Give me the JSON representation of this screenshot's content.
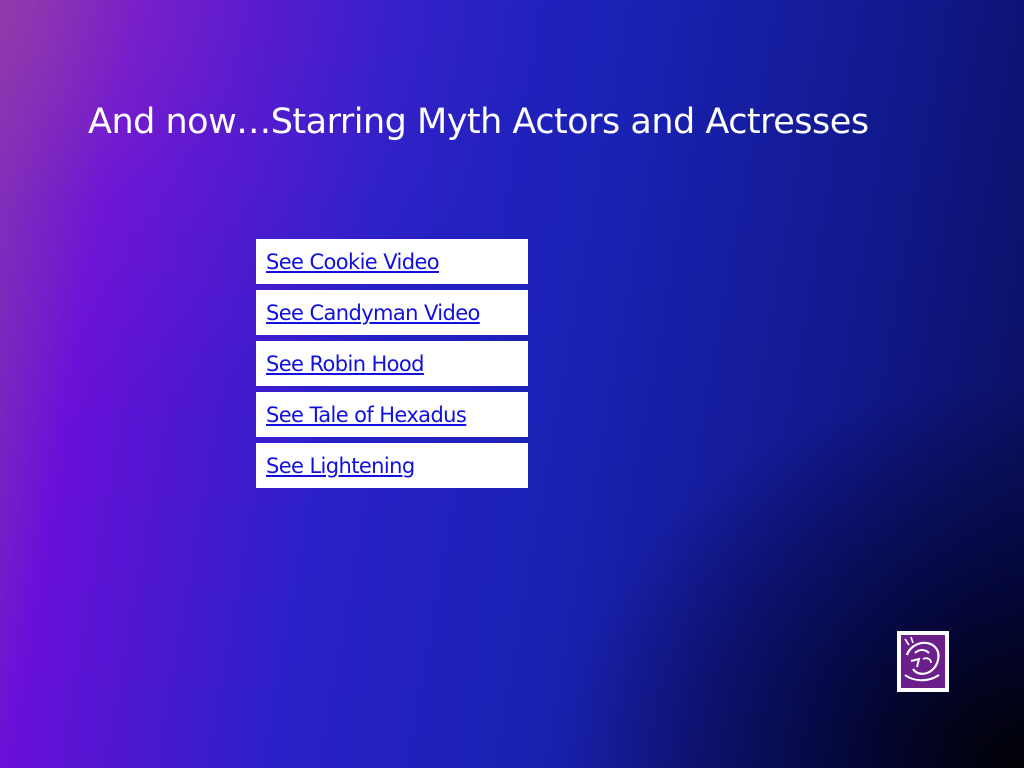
{
  "slide": {
    "title": "And now…Starring Myth Actors and Actresses"
  },
  "links": [
    {
      "label": "See Cookie Video"
    },
    {
      "label": "See Candyman Video"
    },
    {
      "label": "See Robin Hood"
    },
    {
      "label": "See Tale of Hexadus"
    },
    {
      "label": "See Lightening"
    }
  ],
  "icons": {
    "corner": "action-button-icon"
  },
  "colors": {
    "title_text": "#ffffff",
    "link_text": "#1010e0",
    "link_box": "#ffffff",
    "icon_fill": "#6a1f8a"
  }
}
